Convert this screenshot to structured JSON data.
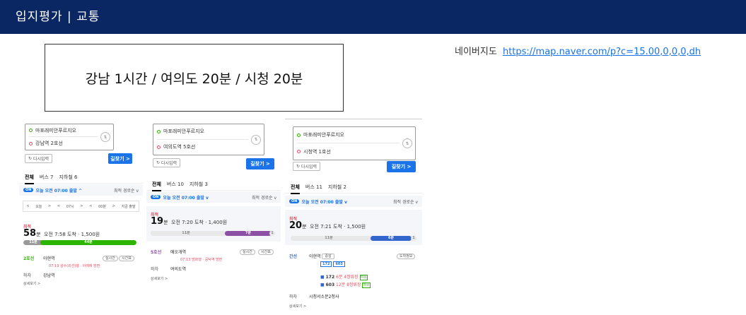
{
  "header": {
    "title": "입지평가 | 교통"
  },
  "summary": "강남 1시간 / 여의도 20분 / 시청 20분",
  "source": {
    "label": "네이버지도",
    "url": "https://map.naver.com/p?c=15.00,0,0,0,dh"
  },
  "panels": [
    {
      "origin": "마포래미안푸르지오",
      "destination": "강남역 2호선",
      "again_label": "다시입력",
      "go_label": "길찾기 >",
      "tabs": [
        "전체",
        "버스 7",
        "지하철 6"
      ],
      "on_badge": "ON",
      "departure": "오늘 오전 07:00 출발 ^",
      "sort": "최적 경로순 v",
      "timebar": [
        "<",
        "오늘",
        ">",
        "<",
        "07시",
        ">",
        "<",
        "00분",
        ">",
        "지금 출발"
      ],
      "best": "최적",
      "minutes": "58",
      "min_unit": "분",
      "arrive": "오전 7:58 도착 · 1,500원",
      "bar_walk": "11분",
      "bar_ride": "44분",
      "steps": [
        {
          "line": "2호선",
          "station": "아현역",
          "detail": "07:13 성수(외선)행 · 아래에 방면"
        },
        {
          "line": "하차",
          "station": "강남역"
        }
      ],
      "buttons": [
        "실시간",
        "시간표"
      ],
      "more": "상세보기 >"
    },
    {
      "origin": "마포래미안푸르지오",
      "destination": "여의도역 5호선",
      "again_label": "다시입력",
      "go_label": "길찾기 >",
      "tabs": [
        "전체",
        "버스 10",
        "지하철 3"
      ],
      "on_badge": "ON",
      "departure": "오늘 오전 07:00 출발 v",
      "sort": "최적 경로순 v",
      "best": "최적",
      "minutes": "19",
      "min_unit": "분",
      "arrive": "오전 7:20 도착 · 1,400원",
      "bar_walk": "11분",
      "bar_ride": "7분",
      "bar_end": "1분",
      "steps": [
        {
          "line": "5호선",
          "station": "애오개역",
          "detail": "07:13 방화행 · 공덕역 방면"
        },
        {
          "line": "하차",
          "station": "여의도역"
        }
      ],
      "buttons": [
        "실시간",
        "시간표"
      ],
      "more": "상세보기 >"
    },
    {
      "origin": "마포래미안푸르지오",
      "destination": "시청역 1호선",
      "again_label": "다시입력",
      "go_label": "길찾기 >",
      "tabs": [
        "전체",
        "버스 11",
        "지하철 2"
      ],
      "on_badge": "ON",
      "departure": "오늘 오전 07:00 출발 v",
      "sort": "최적 경로순 v",
      "best": "최적",
      "minutes": "20",
      "min_unit": "분",
      "arrive": "오전 7:21 도착 · 1,500원",
      "bar_walk": "11분",
      "bar_ride": "6분",
      "bar_end": "1분",
      "steps": [
        {
          "line": "간선",
          "station": "아현역",
          "detail": ""
        },
        {
          "line": "하차",
          "station": "시청서소문2청사"
        }
      ],
      "bus_numbers": [
        "172",
        "603"
      ],
      "bus_rows": [
        {
          "num": "172",
          "time": "6분 4정류장",
          "tag": "여유"
        },
        {
          "num": "603",
          "time": "12분 8정류장",
          "tag": "여유"
        }
      ],
      "stop_badge": "중앙",
      "buttons": [
        "도착정보"
      ],
      "more": "상세보기 >"
    }
  ],
  "colors": {
    "header_bg": "#0b2763",
    "accent": "#1a73e8",
    "subway2": "#2db400",
    "subway5": "#8b50a4",
    "bus_trunk": "#3366cc"
  }
}
